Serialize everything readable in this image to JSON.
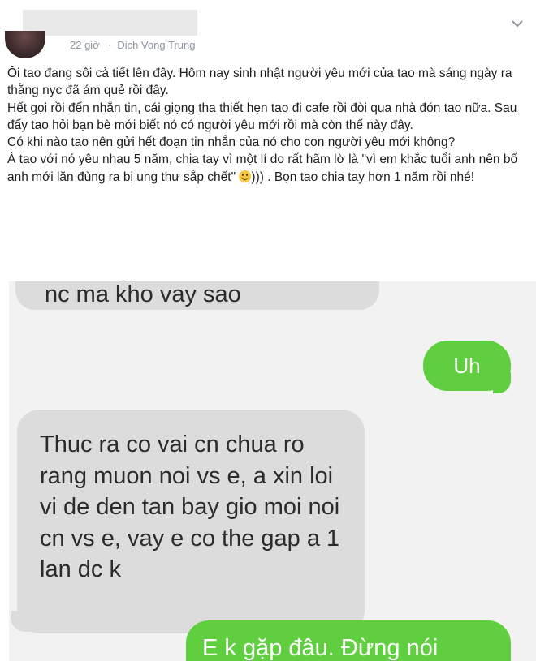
{
  "post": {
    "time": "22 giờ",
    "separator": "·",
    "location": "Dich Vong Trung",
    "paragraphs": [
      "Ôi tao đang sôi cả tiết lên đây. Hôm nay sinh nhật người yêu mới của tao mà sáng ngày ra thằng nyc đã ám quẻ rồi đây.",
      "Hết gọi rồi đến nhắn tin, cái giọng tha thiết hẹn tao đi cafe rồi đòi qua nhà đón tao nữa. Sau đấy tao hỏi bạn bè mới biết nó có người yêu mới rồi mà còn thế này đây.",
      "Có khi nào tao nên gửi hết đoạn tin nhắn của nó cho con người yêu mới không?"
    ],
    "last_paragraph_before_emoji": "À tao với nó yêu nhau 5 năm, chia tay vì một lí do rất hãm lờ là \"vì em khắc tuổi anh nên bố anh mới lăn đùng ra bị ung thư sắp chết\" ",
    "last_paragraph_after_emoji": "))) . Bọn tao chia tay hơn 1 năm rồi nhé!",
    "emoji_icon": "smile-emoji-icon"
  },
  "chat": {
    "messages": [
      {
        "side": "received",
        "text": "nc ma kho vay sao"
      },
      {
        "side": "sent",
        "text": "Uh"
      },
      {
        "side": "received",
        "text": "Thuc ra co vai cn chua ro rang muon noi vs e, a xin loi vi de den tan bay gio moi noi cn vs e, vay e co the gap a 1 lan dc k"
      },
      {
        "side": "sent",
        "text": "E k gặp đâu. Đừng nói"
      }
    ],
    "colors": {
      "received_bubble": "#dcdcdc",
      "sent_bubble": "#5fcf3f"
    }
  }
}
